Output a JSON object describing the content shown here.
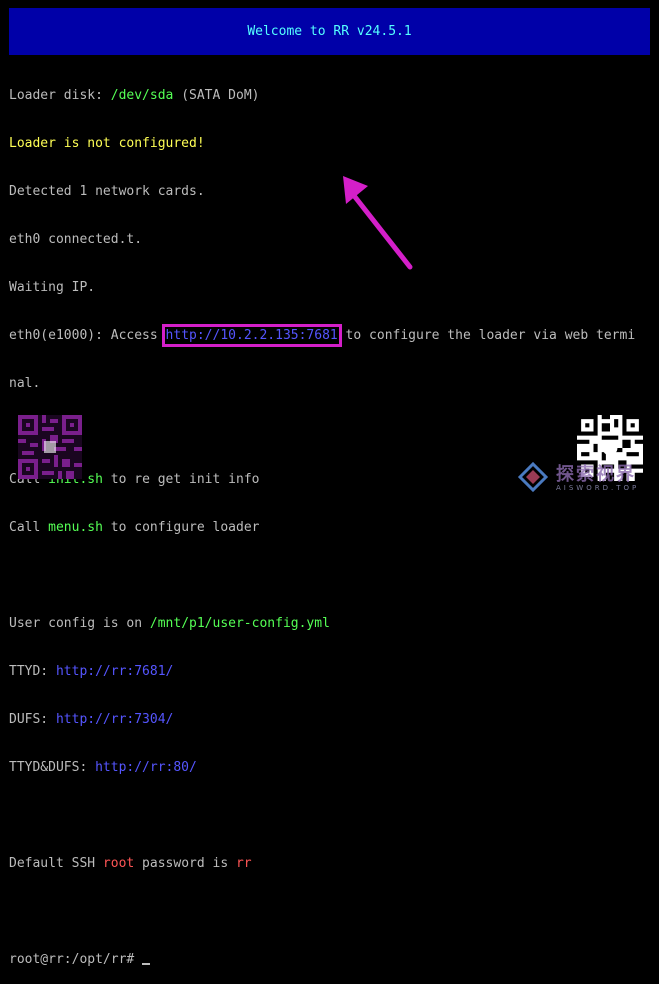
{
  "banner": {
    "title": "Welcome to RR v24.5.1"
  },
  "terminal": {
    "l1_label": "Loader disk: ",
    "l1_value": "/dev/sda",
    "l1_suffix": " (SATA DoM)",
    "l2": "Loader is not configured!",
    "l3": "Detected 1 network cards.",
    "l4": "eth0 connected.t.",
    "l5": "Waiting IP.",
    "l6_prefix": "eth0(e1000): Access ",
    "l6_url": "http://10.2.2.135:7681",
    "l6_suffix": " to configure the loader via web termi",
    "l7": "nal.",
    "l9_prefix": "Call ",
    "l9_cmd": "init.sh",
    "l9_suffix": " to re get init info",
    "l10_prefix": "Call ",
    "l10_cmd": "menu.sh",
    "l10_suffix": " to configure loader",
    "l12_prefix": "User config is on ",
    "l12_path": "/mnt/p1/user-config.yml",
    "l13_label": "TTYD: ",
    "l13_url": "http://rr:7681/",
    "l14_label": "DUFS: ",
    "l14_url": "http://rr:7304/",
    "l15_label": "TTYD&DUFS: ",
    "l15_url": "http://rr:80/",
    "l17_prefix": "Default SSH ",
    "l17_user": "root",
    "l17_mid": " password is ",
    "l17_pass": "rr",
    "l19_prompt": "root@rr:/opt/rr# "
  },
  "watermark": {
    "text": "探索视界",
    "sub": "AISWORD.TOP"
  },
  "colors": {
    "banner_bg": "#0000a8",
    "banner_text": "#55ffff",
    "terminal_text": "#bcbcbc",
    "green": "#55ff55",
    "yellow": "#ffff55",
    "blue": "#5555ff",
    "red": "#ff5555",
    "highlight": "#d41fc9"
  },
  "icons": {
    "left_qr": "qr-code-icon",
    "right_qr": "qr-code-icon",
    "arrow": "arrow-up-left-icon",
    "logo": "watermark-logo-icon"
  }
}
